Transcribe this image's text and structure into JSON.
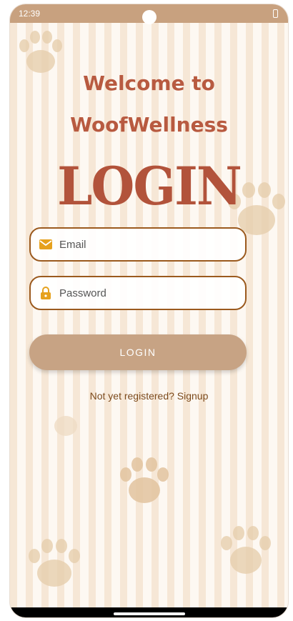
{
  "status_bar": {
    "time": "12:39",
    "battery_icon": "battery-icon"
  },
  "header": {
    "welcome_line1": "Welcome to",
    "welcome_line2": "WoofWellness",
    "login_title": "LOGIN"
  },
  "form": {
    "email": {
      "placeholder": "Email",
      "icon": "envelope-icon"
    },
    "password": {
      "placeholder": "Password",
      "icon": "lock-icon"
    },
    "login_button": "LOGIN",
    "signup_text": "Not yet registered? Signup"
  },
  "colors": {
    "accent": "#b85a40",
    "button": "#c7a384",
    "field_border": "#9b5a1e",
    "icon": "#e6a11d"
  }
}
